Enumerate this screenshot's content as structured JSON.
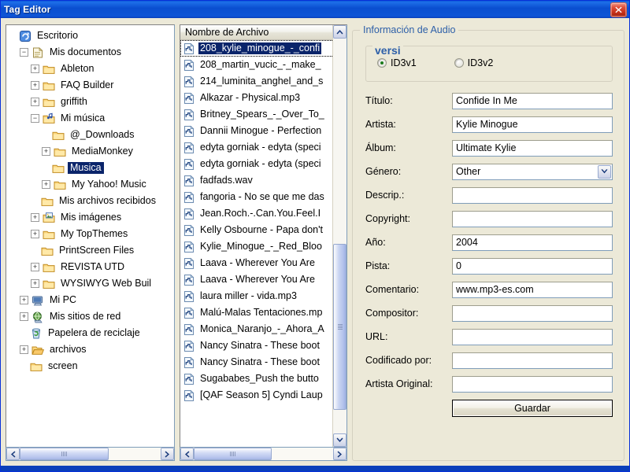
{
  "window": {
    "title": "Tag Editor",
    "close_label": "x",
    "accent_color": "#0A4FD0",
    "face_color": "#ECE9D8",
    "selection_color": "#0A246A"
  },
  "tree": {
    "name": "folder-tree",
    "nodes": [
      {
        "label": "Escritorio",
        "depth": 0,
        "expander": "none",
        "icon": "desktop-icon",
        "selected": false
      },
      {
        "label": "Mis documentos",
        "depth": 1,
        "expander": "minus",
        "icon": "documents-icon",
        "selected": false
      },
      {
        "label": "Ableton",
        "depth": 2,
        "expander": "plus",
        "icon": "folder-icon",
        "selected": false
      },
      {
        "label": "FAQ Builder",
        "depth": 2,
        "expander": "plus",
        "icon": "folder-icon",
        "selected": false
      },
      {
        "label": "griffith",
        "depth": 2,
        "expander": "plus",
        "icon": "folder-icon",
        "selected": false
      },
      {
        "label": "Mi música",
        "depth": 2,
        "expander": "minus",
        "icon": "music-folder-icon",
        "selected": false
      },
      {
        "label": "@_Downloads",
        "depth": 3,
        "expander": "none",
        "icon": "folder-icon",
        "selected": false
      },
      {
        "label": "MediaMonkey",
        "depth": 3,
        "expander": "plus",
        "icon": "folder-icon",
        "selected": false
      },
      {
        "label": "Musica",
        "depth": 3,
        "expander": "none",
        "icon": "folder-icon",
        "selected": true
      },
      {
        "label": "My Yahoo! Music",
        "depth": 3,
        "expander": "plus",
        "icon": "folder-icon",
        "selected": false
      },
      {
        "label": "Mis archivos recibidos",
        "depth": 2,
        "expander": "none",
        "icon": "folder-icon",
        "selected": false
      },
      {
        "label": "Mis imágenes",
        "depth": 2,
        "expander": "plus",
        "icon": "pictures-icon",
        "selected": false
      },
      {
        "label": "My TopThemes",
        "depth": 2,
        "expander": "plus",
        "icon": "folder-icon",
        "selected": false
      },
      {
        "label": "PrintScreen Files",
        "depth": 2,
        "expander": "none",
        "icon": "folder-icon",
        "selected": false
      },
      {
        "label": "REVISTA UTD",
        "depth": 2,
        "expander": "plus",
        "icon": "folder-icon",
        "selected": false
      },
      {
        "label": "WYSIWYG Web Buil",
        "depth": 2,
        "expander": "plus",
        "icon": "folder-icon",
        "selected": false
      },
      {
        "label": "Mi PC",
        "depth": 1,
        "expander": "plus",
        "icon": "computer-icon",
        "selected": false
      },
      {
        "label": "Mis sitios de red",
        "depth": 1,
        "expander": "plus",
        "icon": "network-icon",
        "selected": false
      },
      {
        "label": "Papelera de reciclaje",
        "depth": 1,
        "expander": "none",
        "icon": "recycle-bin-icon",
        "selected": false
      },
      {
        "label": "archivos",
        "depth": 1,
        "expander": "plus",
        "icon": "open-folder-icon",
        "selected": false
      },
      {
        "label": "screen",
        "depth": 1,
        "expander": "none",
        "icon": "folder-icon",
        "selected": false
      }
    ],
    "hscroll": {
      "thumb_left_pct": 0,
      "thumb_width_pct": 63
    }
  },
  "filelist": {
    "header": "Nombre de Archivo",
    "files": [
      {
        "name": "208_kylie_minogue_-_confi",
        "selected": true
      },
      {
        "name": "208_martin_vucic_-_make_",
        "selected": false
      },
      {
        "name": "214_luminita_anghel_and_s",
        "selected": false
      },
      {
        "name": "Alkazar - Physical.mp3",
        "selected": false
      },
      {
        "name": "Britney_Spears_-_Over_To_",
        "selected": false
      },
      {
        "name": "Dannii Minogue - Perfection",
        "selected": false
      },
      {
        "name": "edyta gorniak - edyta (speci",
        "selected": false
      },
      {
        "name": "edyta gorniak - edyta (speci",
        "selected": false
      },
      {
        "name": "fadfads.wav",
        "selected": false
      },
      {
        "name": "fangoria - No se que me das",
        "selected": false
      },
      {
        "name": "Jean.Roch.-.Can.You.Feel.I",
        "selected": false
      },
      {
        "name": "Kelly Osbourne - Papa don't",
        "selected": false
      },
      {
        "name": "Kylie_Minogue_-_Red_Bloo",
        "selected": false
      },
      {
        "name": "Laava - Wherever You Are",
        "selected": false
      },
      {
        "name": "Laava - Wherever You Are",
        "selected": false
      },
      {
        "name": "laura miller - vida.mp3",
        "selected": false
      },
      {
        "name": "Malú-Malas Tentaciones.mp",
        "selected": false
      },
      {
        "name": "Monica_Naranjo_-_Ahora_A",
        "selected": false
      },
      {
        "name": "Nancy Sinatra - These boot",
        "selected": false
      },
      {
        "name": "Nancy Sinatra - These boot",
        "selected": false
      },
      {
        "name": "Sugababes_Push the butto",
        "selected": false
      },
      {
        "name": "[QAF Season 5] Cyndi Laup",
        "selected": false
      }
    ],
    "vscroll": {
      "thumb_top_pct": 52,
      "thumb_height_pct": 42
    },
    "hscroll": {
      "thumb_left_pct": 0,
      "thumb_width_pct": 56
    }
  },
  "info": {
    "group_title": "Información de Audio",
    "version_group_title": "versi",
    "version_options": [
      {
        "label": "ID3v1",
        "selected": true
      },
      {
        "label": "ID3v2",
        "selected": false
      }
    ],
    "fields": [
      {
        "label": "Título:",
        "value": "Confide In Me",
        "type": "text",
        "placeholder": ""
      },
      {
        "label": "Artista:",
        "value": "Kylie Minogue",
        "type": "text",
        "placeholder": ""
      },
      {
        "label": "Álbum:",
        "value": "Ultimate Kylie",
        "type": "text",
        "placeholder": ""
      },
      {
        "label": "Género:",
        "value": "Other",
        "type": "select",
        "placeholder": ""
      },
      {
        "label": "Descrip.:",
        "value": "",
        "type": "text",
        "placeholder": ""
      },
      {
        "label": "Copyright:",
        "value": "",
        "type": "text",
        "placeholder": ""
      },
      {
        "label": "Año:",
        "value": "2004",
        "type": "text",
        "placeholder": ""
      },
      {
        "label": "Pista:",
        "value": "0",
        "type": "text",
        "placeholder": ""
      },
      {
        "label": "Comentario:",
        "value": "www.mp3-es.com",
        "type": "text",
        "placeholder": ""
      },
      {
        "label": "Compositor:",
        "value": "",
        "type": "text",
        "placeholder": ""
      },
      {
        "label": "URL:",
        "value": "",
        "type": "text",
        "placeholder": ""
      },
      {
        "label": "Codificado por:",
        "value": "",
        "type": "text",
        "placeholder": ""
      },
      {
        "label": "Artista Original:",
        "value": "",
        "type": "text",
        "placeholder": ""
      }
    ],
    "save_label": "Guardar"
  }
}
